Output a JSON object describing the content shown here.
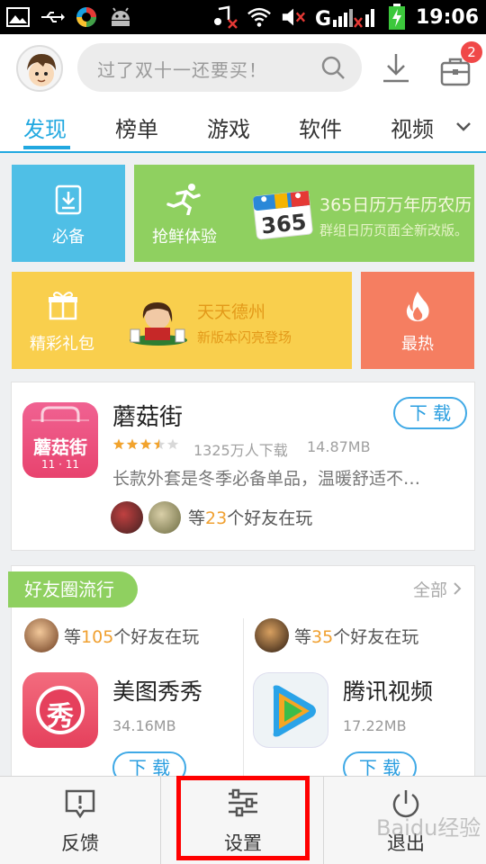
{
  "status_bar": {
    "time": "19:06",
    "network": "G"
  },
  "header": {
    "search_placeholder": "过了双十一还要买！",
    "badge_count": "2"
  },
  "tabs": [
    {
      "label": "发现",
      "active": true
    },
    {
      "label": "榜单",
      "active": false
    },
    {
      "label": "游戏",
      "active": false
    },
    {
      "label": "软件",
      "active": false
    },
    {
      "label": "视频",
      "active": false
    }
  ],
  "tiles": {
    "essential": "必备",
    "try_new": "抢鲜体验",
    "gift": "精彩礼包",
    "hot": "最热",
    "promo1": {
      "title": "365日历万年历农历",
      "subtitle": "群组日历页面全新改版。",
      "badge": "365"
    },
    "promo2": {
      "title": "天天德州",
      "subtitle": "新版本闪亮登场"
    }
  },
  "featured_app": {
    "name": "蘑菇街",
    "icon_text": "蘑菇街",
    "icon_subtext": "11 · 11",
    "download_label": "下 载",
    "rating": 3.5,
    "downloads": "1325万人下载",
    "size": "14.87MB",
    "description": "长款外套是冬季必备单品，温暖舒适不…",
    "friends_prefix": "等",
    "friends_count": "23",
    "friends_suffix": "个好友在玩"
  },
  "friends_circle": {
    "title": "好友圈流行",
    "all_label": "全部",
    "apps": [
      {
        "friends_prefix": "等",
        "friends_count": "105",
        "friends_suffix": "个好友在玩",
        "name": "美图秀秀",
        "icon_text": "秀",
        "size": "34.16MB",
        "download_label": "下 载"
      },
      {
        "friends_prefix": "等",
        "friends_count": "35",
        "friends_suffix": "个好友在玩",
        "name": "腾讯视频",
        "size": "17.22MB",
        "download_label": "下 载"
      }
    ]
  },
  "bottom_bar": {
    "feedback": "反馈",
    "settings": "设置",
    "exit": "退出"
  },
  "watermark": "Baidu经验",
  "colors": {
    "accent": "#21a8e0",
    "blue_tile": "#4fbfe6",
    "green_tile": "#8fd060",
    "yellow_tile": "#f9cf4d",
    "red_tile": "#f57e61",
    "highlight": "#ff0000"
  }
}
